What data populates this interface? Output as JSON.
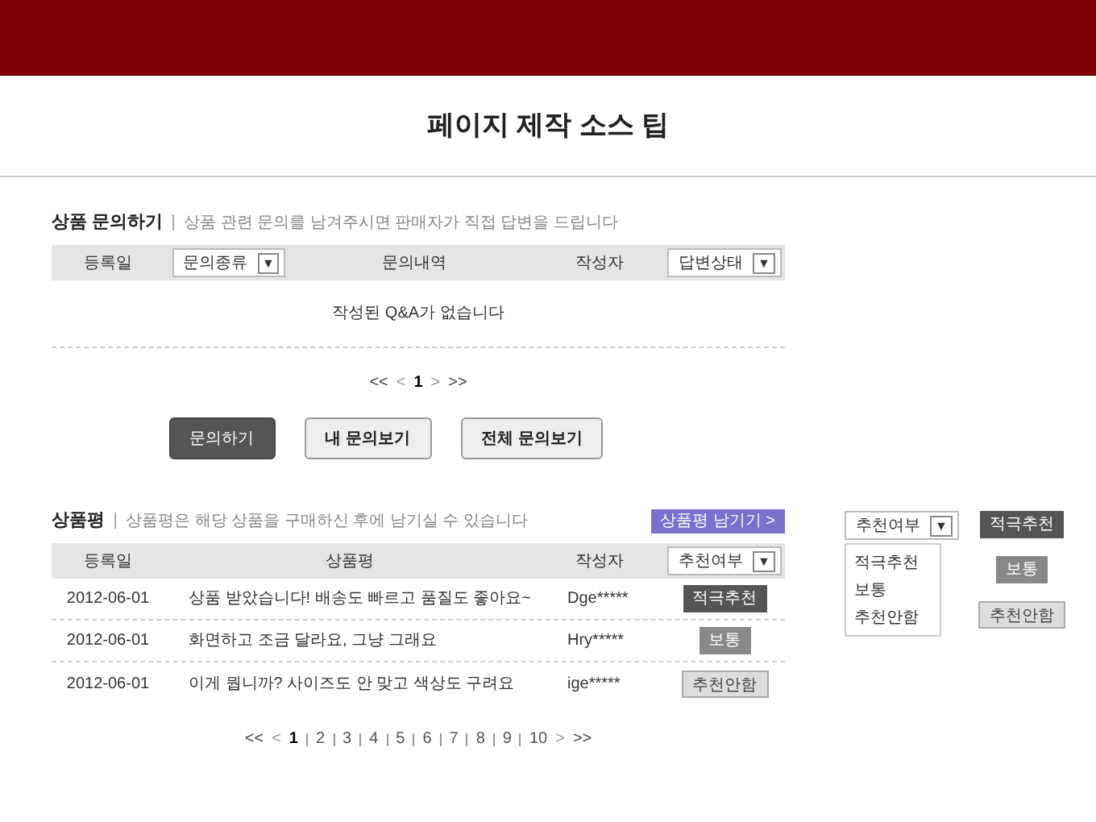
{
  "page_title": "페이지 제작 소스 팁",
  "inquiry": {
    "title": "상품 문의하기",
    "note": "상품 관련 문의를 남겨주시면 판매자가 직접 답변을 드립니다",
    "columns": [
      {
        "kind": "text",
        "label": "등록일"
      },
      {
        "kind": "select",
        "label": "문의종류",
        "caret": "▼"
      },
      {
        "kind": "text",
        "label": "문의내역"
      },
      {
        "kind": "text",
        "label": "작성자"
      },
      {
        "kind": "select",
        "label": "답변상태",
        "caret": "▼"
      }
    ],
    "empty_message": "작성된 Q&A가 없습니다",
    "pagination": {
      "first": "<<",
      "prev": "<",
      "pages": [
        {
          "label": "1",
          "selected": true
        }
      ],
      "next": ">",
      "last": ">>"
    },
    "buttons": [
      {
        "label": "문의하기",
        "kind": "primary"
      },
      {
        "label": "내 문의보기",
        "kind": "secondary"
      },
      {
        "label": "전체 문의보기",
        "kind": "secondary"
      }
    ]
  },
  "reviews": {
    "title": "상품평",
    "note": "상품평은 해당 상품을 구매하신 후에 남기실 수 있습니다",
    "write_button": "상품평 남기기 >",
    "columns": [
      {
        "kind": "text",
        "label": "등록일"
      },
      {
        "kind": "text",
        "label": "상품평"
      },
      {
        "kind": "text",
        "label": "작성자"
      },
      {
        "kind": "select",
        "label": "추천여부",
        "caret": "▼"
      }
    ],
    "rows": [
      {
        "date": "2012-06-01",
        "review": "상품 받았습니다! 배송도 빠르고 품질도 좋아요~",
        "author": "Dge*****",
        "badge": "적극추천",
        "kind": "strong"
      },
      {
        "date": "2012-06-01",
        "review": "화면하고 조금 달라요, 그냥 그래요",
        "author": "Hry*****",
        "badge": "보통",
        "kind": "normal"
      },
      {
        "date": "2012-06-01",
        "review": "이게 뭡니까? 사이즈도 안 맞고 색상도 구려요",
        "author": "ige*****",
        "badge": "추천안함",
        "kind": "not"
      }
    ],
    "pagination": {
      "first": "<<",
      "prev": "<",
      "pages": [
        {
          "label": "1",
          "selected": true
        },
        {
          "label": "2",
          "selected": false
        },
        {
          "label": "3",
          "selected": false
        },
        {
          "label": "4",
          "selected": false
        },
        {
          "label": "5",
          "selected": false
        },
        {
          "label": "6",
          "selected": false
        },
        {
          "label": "7",
          "selected": false
        },
        {
          "label": "8",
          "selected": false
        },
        {
          "label": "9",
          "selected": false
        },
        {
          "label": "10",
          "selected": false
        }
      ],
      "next": ">",
      "last": ">>"
    }
  },
  "legend": {
    "dropdown": {
      "label": "추천여부",
      "caret": "▼",
      "options": [
        "적극추천",
        "보통",
        "추천안함"
      ]
    },
    "badges": [
      {
        "label": "적극추천",
        "kind": "strong"
      },
      {
        "label": "보통",
        "kind": "normal"
      },
      {
        "label": "추천안함",
        "kind": "not"
      }
    ]
  }
}
